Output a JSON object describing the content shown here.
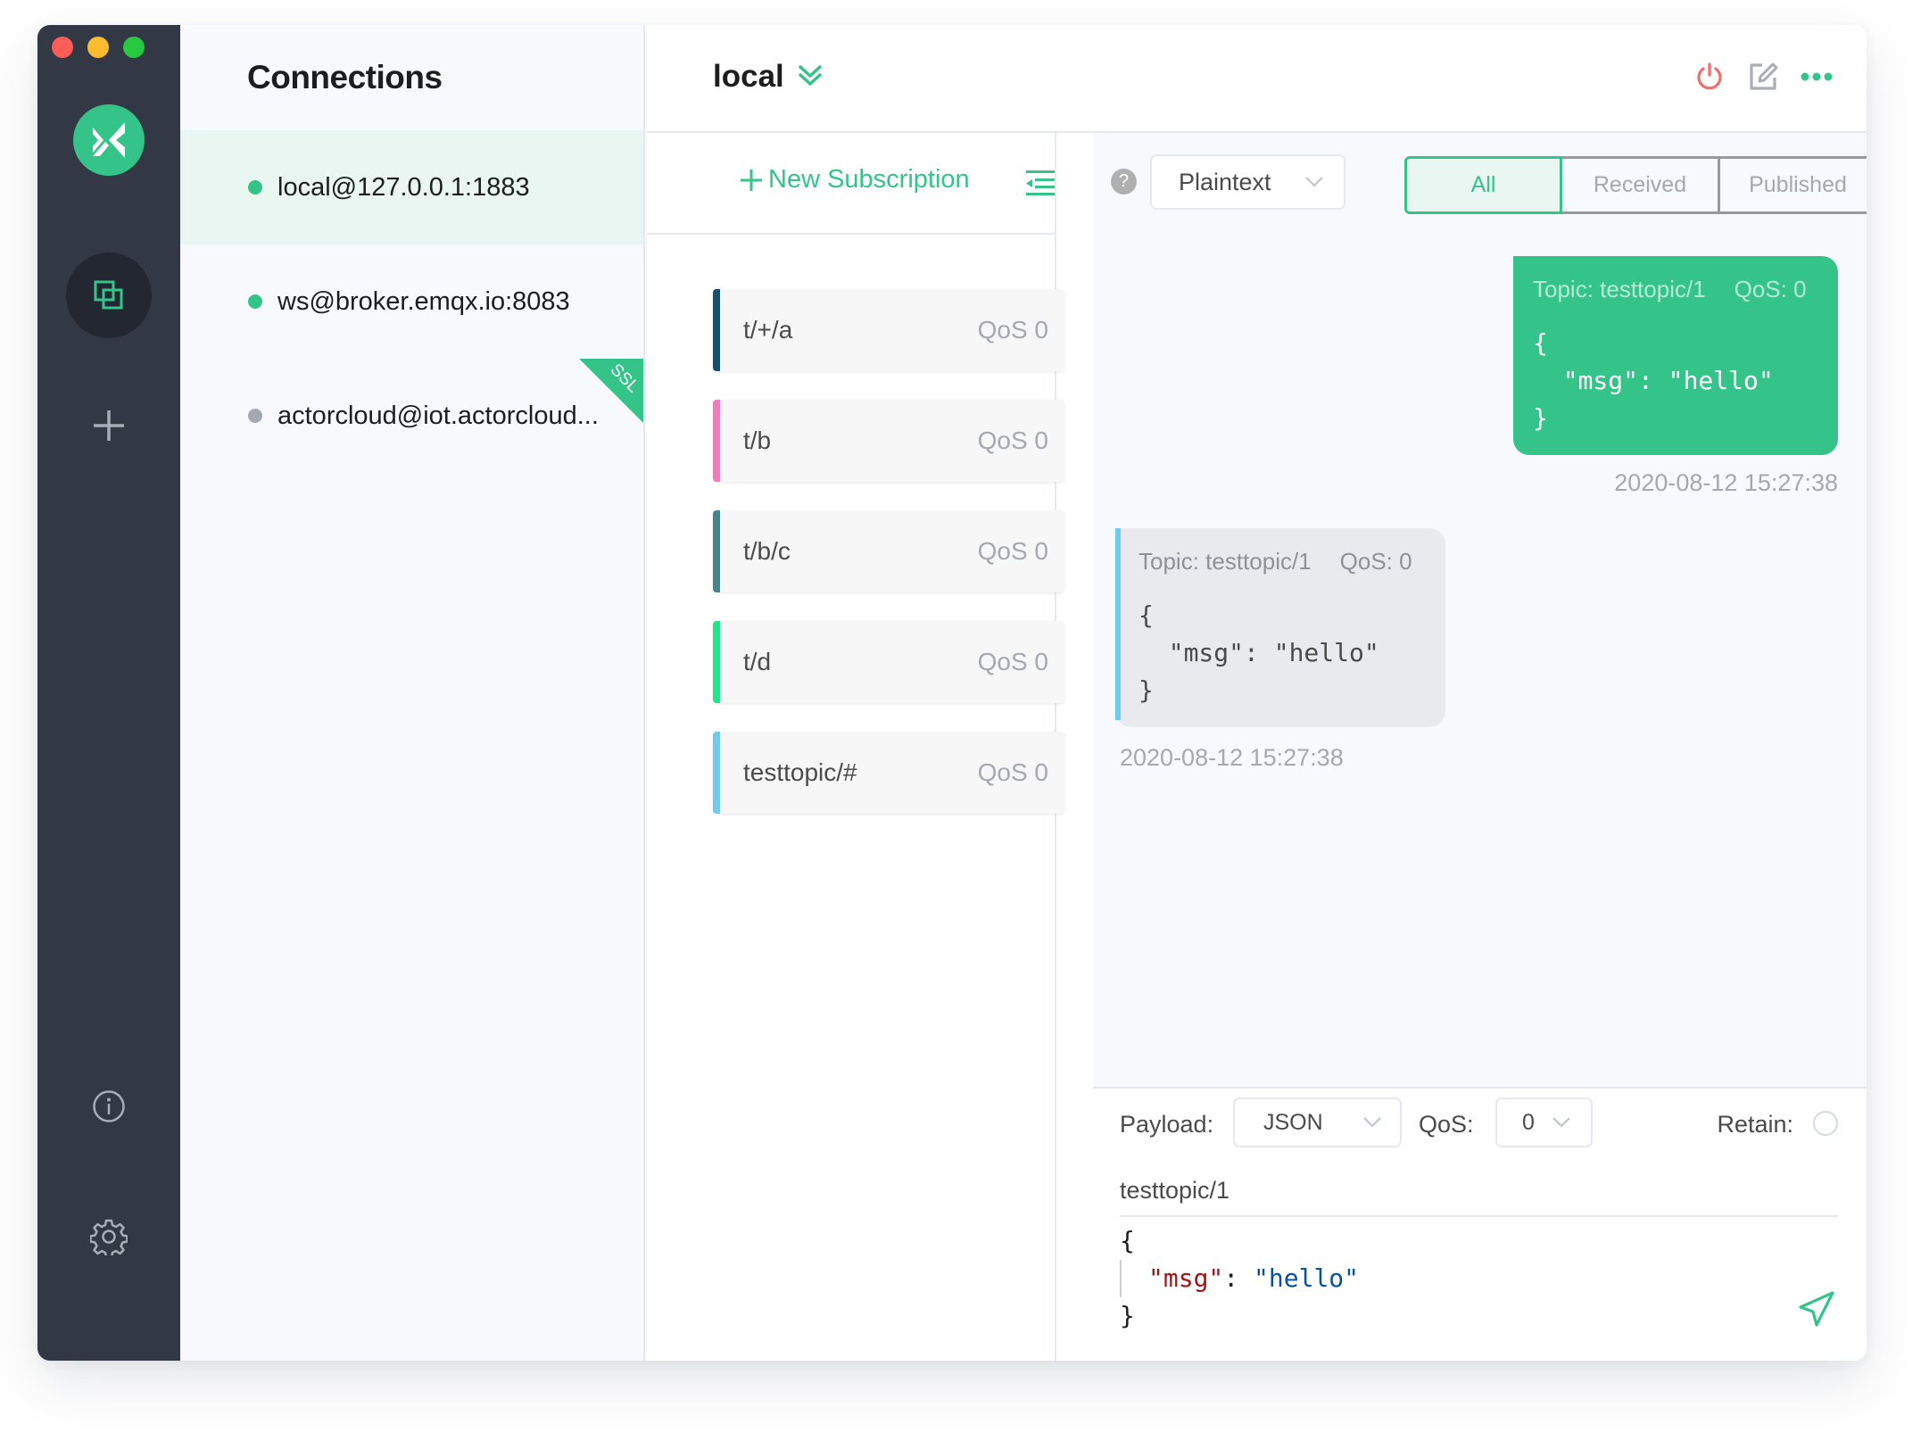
{
  "app": {
    "colors": {
      "accent": "#34c388",
      "danger": "#f56c6c",
      "nav_bg": "#333845",
      "offline": "#a2a9b0"
    }
  },
  "nav": {
    "items": [
      {
        "id": "connections",
        "icon": "connections-icon",
        "active": true
      },
      {
        "id": "new",
        "icon": "plus-icon",
        "active": false
      },
      {
        "id": "about",
        "icon": "info-icon",
        "active": false
      },
      {
        "id": "settings",
        "icon": "gear-icon",
        "active": false
      }
    ]
  },
  "connections": {
    "title": "Connections",
    "items": [
      {
        "name": "local@127.0.0.1:1883",
        "status": "connected",
        "status_color": "#34c388",
        "active": true,
        "ssl": false
      },
      {
        "name": "ws@broker.emqx.io:8083",
        "status": "connected",
        "status_color": "#34c388",
        "active": false,
        "ssl": false
      },
      {
        "name": "actorcloud@iot.actorcloud...",
        "status": "disconnected",
        "status_color": "#a2a9b0",
        "active": false,
        "ssl": true,
        "ssl_label": "SSL"
      }
    ]
  },
  "header": {
    "connection_name": "local",
    "actions": [
      "power-icon",
      "edit-icon",
      "more-icon"
    ]
  },
  "subscriptions": {
    "new_label": "New Subscription",
    "items": [
      {
        "topic": "t/+/a",
        "qos": "QoS 0",
        "color": "#15516e"
      },
      {
        "topic": "t/b",
        "qos": "QoS 0",
        "color": "#f27bbf"
      },
      {
        "topic": "t/b/c",
        "qos": "QoS 0",
        "color": "#45838e"
      },
      {
        "topic": "t/d",
        "qos": "QoS 0",
        "color": "#22e58a"
      },
      {
        "topic": "testtopic/#",
        "qos": "QoS 0",
        "color": "#6ecbee"
      }
    ]
  },
  "messages": {
    "format": "Plaintext",
    "tabs": [
      {
        "label": "All",
        "active": true
      },
      {
        "label": "Received",
        "active": false
      },
      {
        "label": "Published",
        "active": false
      }
    ],
    "list": [
      {
        "direction": "published",
        "topic": "Topic: testtopic/1",
        "qos": "QoS: 0",
        "payload": "{\n  \"msg\": \"hello\"\n}",
        "time": "2020-08-12 15:27:38"
      },
      {
        "direction": "received",
        "topic": "Topic: testtopic/1",
        "qos": "QoS: 0",
        "payload": "{\n  \"msg\": \"hello\"\n}",
        "time": "2020-08-12 15:27:38"
      }
    ]
  },
  "publish": {
    "payload_label": "Payload:",
    "payload_format": "JSON",
    "qos_label": "QoS:",
    "qos_value": "0",
    "retain_label": "Retain:",
    "retain": false,
    "topic": "testtopic/1",
    "payload_lines": {
      "open": "{",
      "key": "\"msg\"",
      "colon": ": ",
      "value": "\"hello\"",
      "close": "}"
    }
  }
}
